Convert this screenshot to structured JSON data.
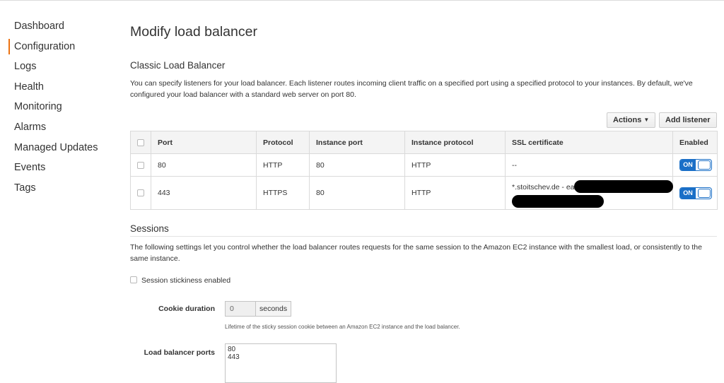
{
  "sidebar": {
    "items": [
      {
        "label": "Dashboard"
      },
      {
        "label": "Configuration",
        "active": true
      },
      {
        "label": "Logs"
      },
      {
        "label": "Health"
      },
      {
        "label": "Monitoring"
      },
      {
        "label": "Alarms"
      },
      {
        "label": "Managed Updates"
      },
      {
        "label": "Events"
      },
      {
        "label": "Tags"
      }
    ]
  },
  "page": {
    "title": "Modify load balancer"
  },
  "classic": {
    "heading": "Classic Load Balancer",
    "description": "You can specify listeners for your load balancer. Each listener routes incoming client traffic on a specified port using a specified protocol to your instances. By default, we've configured your load balancer with a standard web server on port 80.",
    "actions_label": "Actions",
    "add_listener_label": "Add listener"
  },
  "listeners": {
    "columns": [
      "Port",
      "Protocol",
      "Instance port",
      "Instance protocol",
      "SSL certificate",
      "Enabled"
    ],
    "rows": [
      {
        "port": "80",
        "protocol": "HTTP",
        "instance_port": "80",
        "instance_protocol": "HTTP",
        "ssl": "--",
        "enabled": "ON"
      },
      {
        "port": "443",
        "protocol": "HTTPS",
        "instance_port": "80",
        "instance_protocol": "HTTP",
        "ssl": "*.stoitschev.de - ea",
        "enabled": "ON"
      }
    ]
  },
  "sessions": {
    "heading": "Sessions",
    "description": "The following settings let you control whether the load balancer routes requests for the same session to the Amazon EC2 instance with the smallest load, or consistently to the same instance.",
    "stickiness_label": "Session stickiness enabled",
    "stickiness_checked": false,
    "cookie_duration_label": "Cookie duration",
    "cookie_duration_value": "0",
    "cookie_duration_unit": "seconds",
    "cookie_hint": "Lifetime of the sticky session cookie between an Amazon EC2 instance and the load balancer.",
    "ports_label": "Load balancer ports",
    "ports": [
      "80",
      "443"
    ]
  },
  "colors": {
    "accent": "#ec7211",
    "toggle": "#1a6fc7"
  }
}
